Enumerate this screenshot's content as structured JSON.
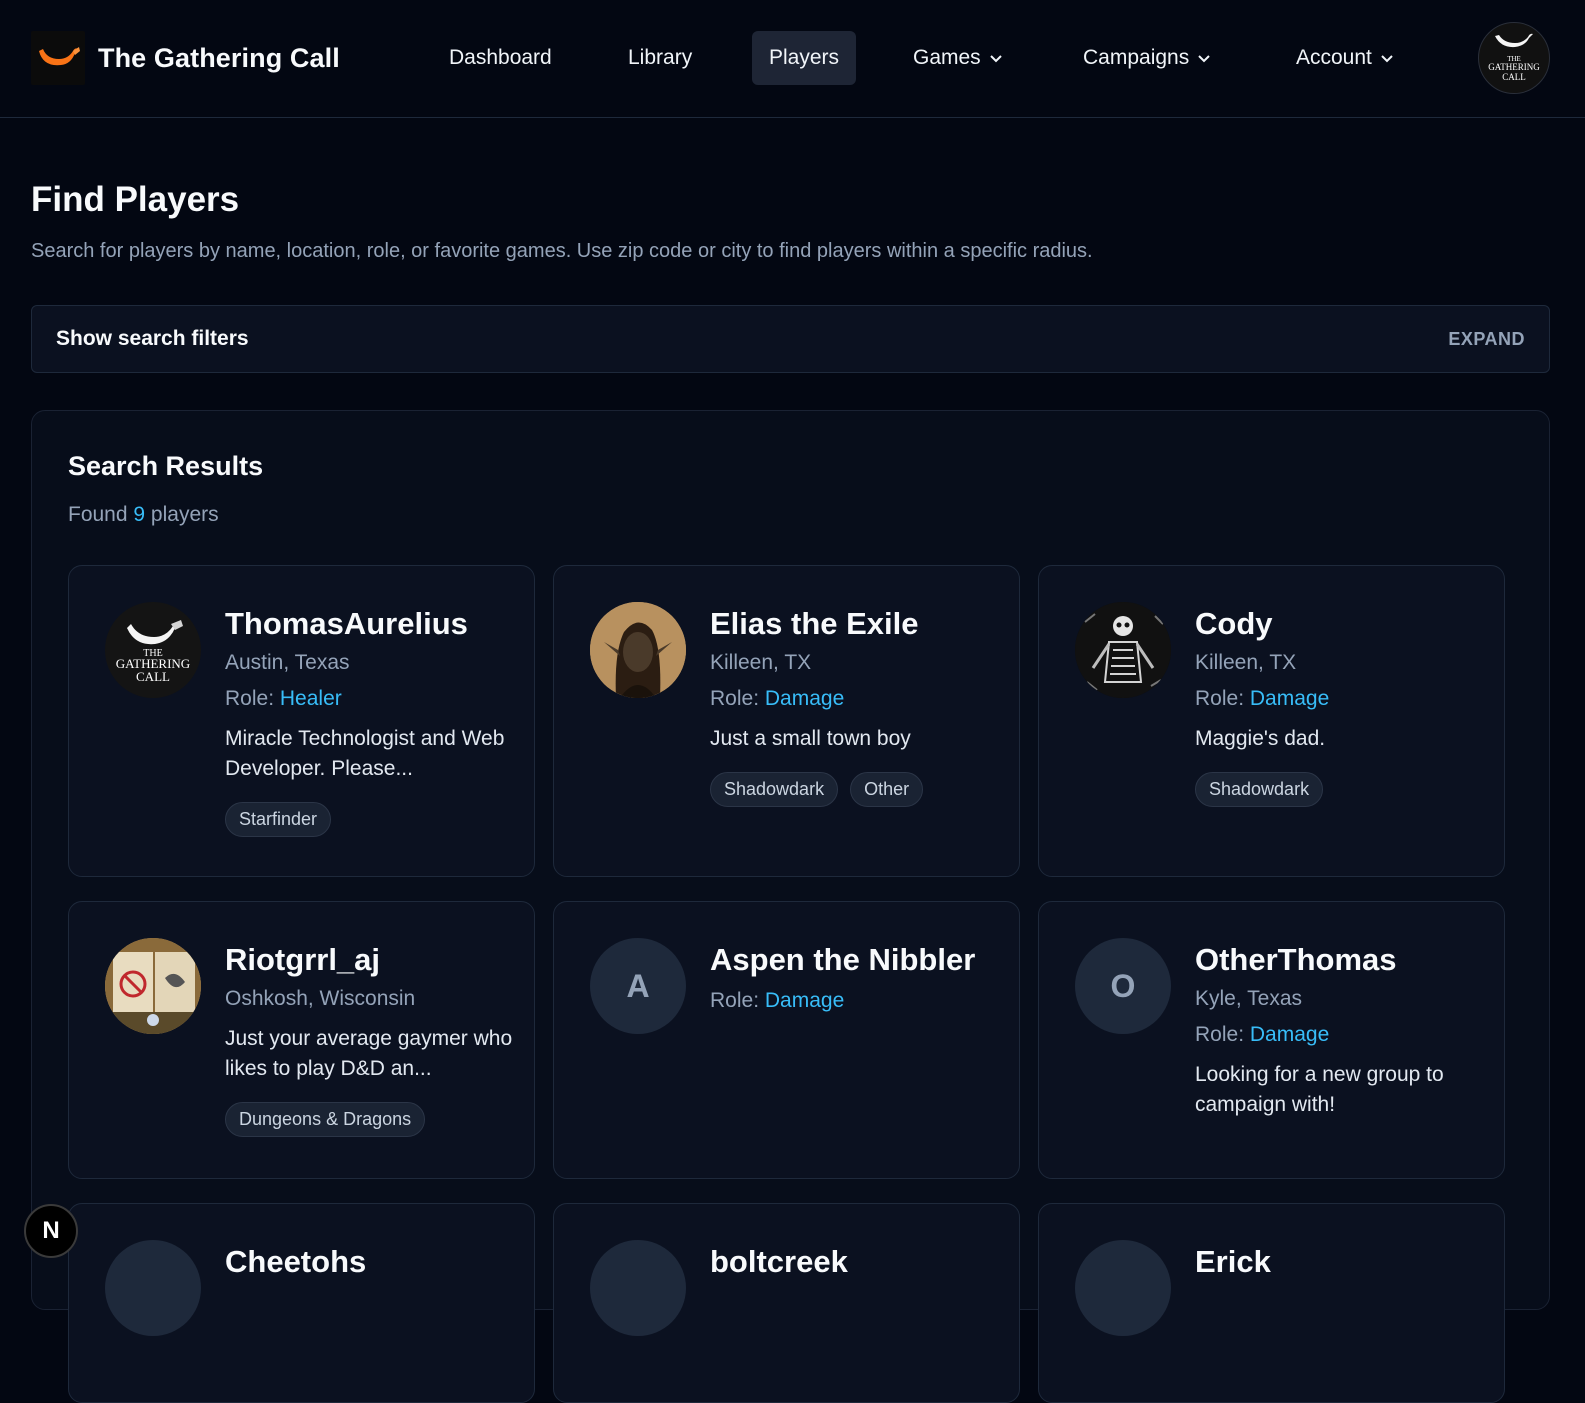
{
  "brand": {
    "title": "The Gathering Call"
  },
  "nav": {
    "items": [
      {
        "label": "Dashboard",
        "active": false,
        "dropdown": false
      },
      {
        "label": "Library",
        "active": false,
        "dropdown": false
      },
      {
        "label": "Players",
        "active": true,
        "dropdown": false
      },
      {
        "label": "Games",
        "active": false,
        "dropdown": true
      },
      {
        "label": "Campaigns",
        "active": false,
        "dropdown": true
      },
      {
        "label": "Account",
        "active": false,
        "dropdown": true
      }
    ],
    "avatar_text": [
      "THE",
      "GATHERING",
      "CALL"
    ]
  },
  "page": {
    "title": "Find Players",
    "description": "Search for players by name, location, role, or favorite games. Use zip code or city to find players within a specific radius."
  },
  "filters": {
    "label": "Show search filters",
    "toggle": "EXPAND"
  },
  "results": {
    "title": "Search Results",
    "count_prefix": "Found",
    "count": "9",
    "count_suffix": "players",
    "role_label": "Role:",
    "players": [
      {
        "name": "ThomasAurelius",
        "location": "Austin, Texas",
        "role": "Healer",
        "bio": "Miracle Technologist and Web Developer. Please...",
        "tags": [
          "Starfinder"
        ],
        "avatar": "gathering-call-logo"
      },
      {
        "name": "Elias the Exile",
        "location": "Killeen, TX",
        "role": "Damage",
        "bio": "Just a small town boy",
        "tags": [
          "Shadowdark",
          "Other"
        ],
        "avatar": "elf-portrait"
      },
      {
        "name": "Cody",
        "location": "Killeen, TX",
        "role": "Damage",
        "bio": "Maggie's dad.",
        "tags": [
          "Shadowdark"
        ],
        "avatar": "skeleton-art"
      },
      {
        "name": "Riotgrrl_aj",
        "location": "Oshkosh, Wisconsin",
        "role": "",
        "bio": "Just your average gaymer who likes to play D&D an...",
        "tags": [
          "Dungeons & Dragons"
        ],
        "avatar": "sign-photo"
      },
      {
        "name": "Aspen the Nibbler",
        "location": "",
        "role": "Damage",
        "bio": "",
        "tags": [],
        "avatar": "initial",
        "initial": "A"
      },
      {
        "name": "OtherThomas",
        "location": "Kyle, Texas",
        "role": "Damage",
        "bio": "Looking for a new group to campaign with!",
        "tags": [],
        "avatar": "initial",
        "initial": "O"
      },
      {
        "name": "Cheetohs",
        "location": "",
        "role": "",
        "bio": "",
        "tags": [],
        "avatar": "initial",
        "initial": ""
      },
      {
        "name": "boltcreek",
        "location": "",
        "role": "",
        "bio": "",
        "tags": [],
        "avatar": "initial",
        "initial": ""
      },
      {
        "name": "Erick",
        "location": "",
        "role": "",
        "bio": "",
        "tags": [],
        "avatar": "initial",
        "initial": ""
      }
    ]
  },
  "badge": {
    "letter": "N"
  },
  "colors": {
    "background": "#030712",
    "accent": "#38bdf8",
    "card": "#0b1120",
    "muted": "#94a3b8"
  }
}
